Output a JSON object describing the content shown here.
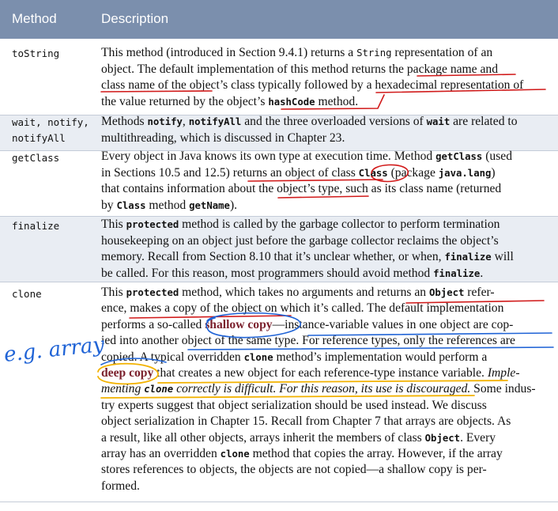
{
  "header": {
    "method_label": "Method",
    "description_label": "Description"
  },
  "rows": [
    {
      "method_lines": [
        "toString"
      ],
      "lines": [
        [
          [
            "t",
            "This method (introduced in Section 9.4.1) returns a "
          ],
          [
            "c",
            "String"
          ],
          [
            "t",
            " representation of an"
          ]
        ],
        [
          [
            "t",
            "object. The default implementation of this method returns the package name and"
          ]
        ],
        [
          [
            "t",
            "class name of the object’s class typically followed by a hexadecimal representation of"
          ]
        ],
        [
          [
            "t",
            "the value returned by the object’s "
          ],
          [
            "cb",
            "hashCode"
          ],
          [
            "t",
            " method."
          ]
        ]
      ]
    },
    {
      "method_lines": [
        "wait, notify,",
        "notifyAll"
      ],
      "lines": [
        [
          [
            "t",
            "Methods "
          ],
          [
            "cb",
            "notify"
          ],
          [
            "t",
            ", "
          ],
          [
            "cb",
            "notifyAll"
          ],
          [
            "t",
            " and the three overloaded versions of "
          ],
          [
            "cb",
            "wait"
          ],
          [
            "t",
            " are related to"
          ]
        ],
        [
          [
            "t",
            "multithreading, which is discussed in Chapter 23."
          ]
        ]
      ]
    },
    {
      "method_lines": [
        "getClass"
      ],
      "lines": [
        [
          [
            "t",
            "Every object in Java knows its own type at execution time. Method "
          ],
          [
            "cb",
            "getClass"
          ],
          [
            "t",
            " (used"
          ]
        ],
        [
          [
            "t",
            "in Sections 10.5 and 12.5) returns an object of class "
          ],
          [
            "cb",
            "Class"
          ],
          [
            "t",
            " (package "
          ],
          [
            "cb",
            "java.lang"
          ],
          [
            "t",
            ")"
          ]
        ],
        [
          [
            "t",
            "that contains information about the object’s type, such as its class name (returned"
          ]
        ],
        [
          [
            "t",
            "by "
          ],
          [
            "cb",
            "Class"
          ],
          [
            "t",
            " method "
          ],
          [
            "cb",
            "getName"
          ],
          [
            "t",
            ")."
          ]
        ]
      ]
    },
    {
      "method_lines": [
        "finalize"
      ],
      "lines": [
        [
          [
            "t",
            "This "
          ],
          [
            "cb",
            "protected"
          ],
          [
            "t",
            " method is called by the garbage collector to perform termination"
          ]
        ],
        [
          [
            "t",
            "housekeeping on an object just before the garbage collector reclaims the object’s"
          ]
        ],
        [
          [
            "t",
            "memory. Recall from Section 8.10 that it’s unclear whether, or when, "
          ],
          [
            "cb",
            "finalize"
          ],
          [
            "t",
            " will"
          ]
        ],
        [
          [
            "t",
            "be called. For this reason, most programmers should avoid method "
          ],
          [
            "cb",
            "finalize"
          ],
          [
            "t",
            "."
          ]
        ]
      ]
    },
    {
      "method_lines": [
        "clone"
      ],
      "lines": [
        [
          [
            "t",
            "This "
          ],
          [
            "cb",
            "protected"
          ],
          [
            "t",
            " method, which takes no arguments and returns an "
          ],
          [
            "cb",
            "Object"
          ],
          [
            "t",
            " refer-"
          ]
        ],
        [
          [
            "t",
            "ence, makes a copy of the object on which it’s called. The default implementation"
          ]
        ],
        [
          [
            "t",
            "performs a so-called "
          ],
          [
            "b",
            "shallow copy"
          ],
          [
            "t",
            "—instance-variable values in one object are cop-"
          ]
        ],
        [
          [
            "t",
            "ied into another object of the same type. For reference types, only the references are"
          ]
        ],
        [
          [
            "t",
            "copied. A typical overridden "
          ],
          [
            "cb",
            "clone"
          ],
          [
            "t",
            " method’s implementation would perform a"
          ]
        ],
        [
          [
            "b",
            "deep copy"
          ],
          [
            "t",
            " that creates a new object for each reference-type instance variable. "
          ],
          [
            "i",
            "Imple-"
          ]
        ],
        [
          [
            "i",
            "menting "
          ],
          [
            "ci",
            "clone"
          ],
          [
            "i",
            " correctly is difficult. For this reason, its use is discouraged."
          ],
          [
            "t",
            " Some indus-"
          ]
        ],
        [
          [
            "t",
            "try experts suggest that object serialization should be used instead. We discuss"
          ]
        ],
        [
          [
            "t",
            "object serialization in Chapter 15. Recall from Chapter 7 that arrays are objects. As"
          ]
        ],
        [
          [
            "t",
            "a result, like all other objects, arrays inherit the members of class "
          ],
          [
            "cb",
            "Object"
          ],
          [
            "t",
            ". Every"
          ]
        ],
        [
          [
            "t",
            "array has an overridden "
          ],
          [
            "cb",
            "clone"
          ],
          [
            "t",
            " method that copies the array. However, if the array"
          ]
        ],
        [
          [
            "t",
            "stores references to objects, the objects are not copied—a shallow copy is per-"
          ]
        ],
        [
          [
            "t",
            "formed."
          ]
        ]
      ]
    }
  ],
  "annotation": {
    "handwritten_note": "e.g. array"
  },
  "colors": {
    "header_bg": "#7b8fad",
    "band_bg": "#e9edf3",
    "red_ink": "#d11a1a",
    "blue_ink": "#1f63d6",
    "yellow_ink": "#f2b200",
    "bold_term": "#7a1f2b"
  }
}
